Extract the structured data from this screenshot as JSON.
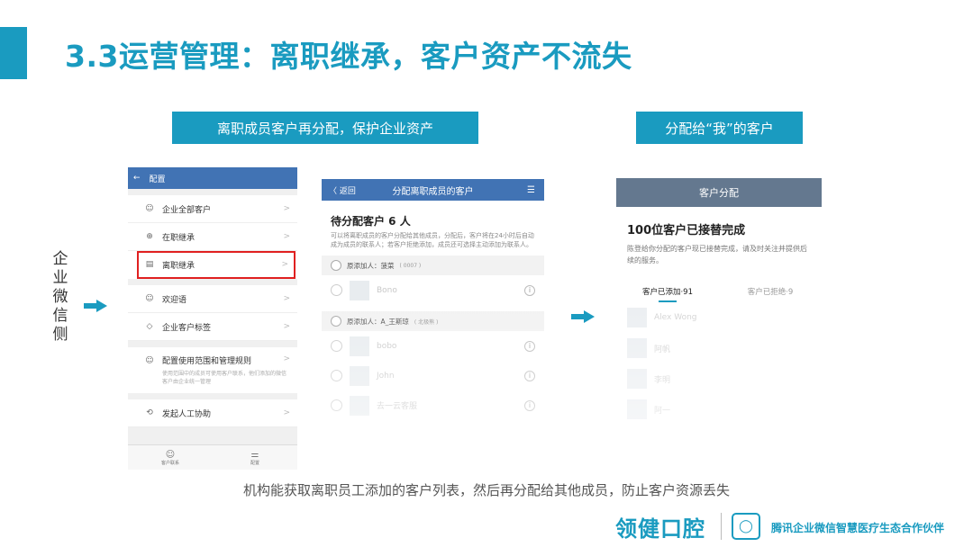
{
  "title": "3.3运营管理：离职继承，客户资产不流失",
  "caption_left": "离职成员客户再分配，保护企业资产",
  "caption_right": "分配给“我”的客户",
  "vertical_label": [
    "企",
    "业",
    "微",
    "信",
    "侧"
  ],
  "phone1": {
    "header": "配置",
    "back_glyph": "←",
    "items": [
      {
        "icon": "☺",
        "label": "企业全部客户"
      },
      {
        "icon": "⊕",
        "label": "在职继承"
      },
      {
        "icon": "▤",
        "label": "离职继承"
      }
    ],
    "items2": [
      {
        "icon": "☺",
        "label": "欢迎语"
      },
      {
        "icon": "◇",
        "label": "企业客户标签"
      }
    ],
    "rule": {
      "icon": "☺",
      "label": "配置使用范围和管理规则",
      "desc": "使用范围中的成员可使用客户联系，他们添加的微信客户由企业统一管理"
    },
    "assist": {
      "icon": "⟲",
      "label": "发起人工协助"
    },
    "tabs": [
      {
        "icon": "☺",
        "label": "客户联系"
      },
      {
        "icon": "⚌",
        "label": "配置"
      }
    ]
  },
  "phone2": {
    "back": "〈 返回",
    "header": "分配离职成员的客户",
    "action": "☰",
    "heading": "待分配客户 6 人",
    "desc": "可以将离职成员的客户分配给其他成员，分配后，客户将在24小时后自动成为成员的联系人；若客户拒绝添加，成员还可选择主动添加为联系人。",
    "groups": [
      {
        "label": "原添加人：菠菜",
        "code": "( 0007 )",
        "rows": [
          {
            "name": "Bono"
          }
        ]
      },
      {
        "label": "原添加人：A_王斯琼",
        "code": "( 北极熊 )",
        "rows": [
          {
            "name": "bobo"
          },
          {
            "name": "John"
          },
          {
            "name": "去一云客服"
          }
        ]
      }
    ]
  },
  "phone3": {
    "header": "客户分配",
    "heading": "100位客户已接替完成",
    "desc": "陈登给你分配的客户现已接替完成，请及时关注并提供后续的服务。",
    "tabs": [
      {
        "label": "客户已添加·91",
        "active": true
      },
      {
        "label": "客户已拒绝·9",
        "active": false
      }
    ],
    "rows": [
      {
        "name": "Alex Wong"
      },
      {
        "name": "阿帆"
      },
      {
        "name": "李明"
      },
      {
        "name": "阿一"
      }
    ]
  },
  "bottom_caption": "机构能获取离职员工添加的客户列表，然后再分配给其他成员，防止客户资源丢失",
  "brand": {
    "name": "领健口腔",
    "logo_glyph": "◯",
    "tagline": "腾讯企业微信智慧医疗生态合作伙伴"
  },
  "colors": {
    "accent": "#1a9bc0",
    "header_blue": "#4173b4",
    "header_gray": "#64788f",
    "highlight": "#e02020"
  }
}
